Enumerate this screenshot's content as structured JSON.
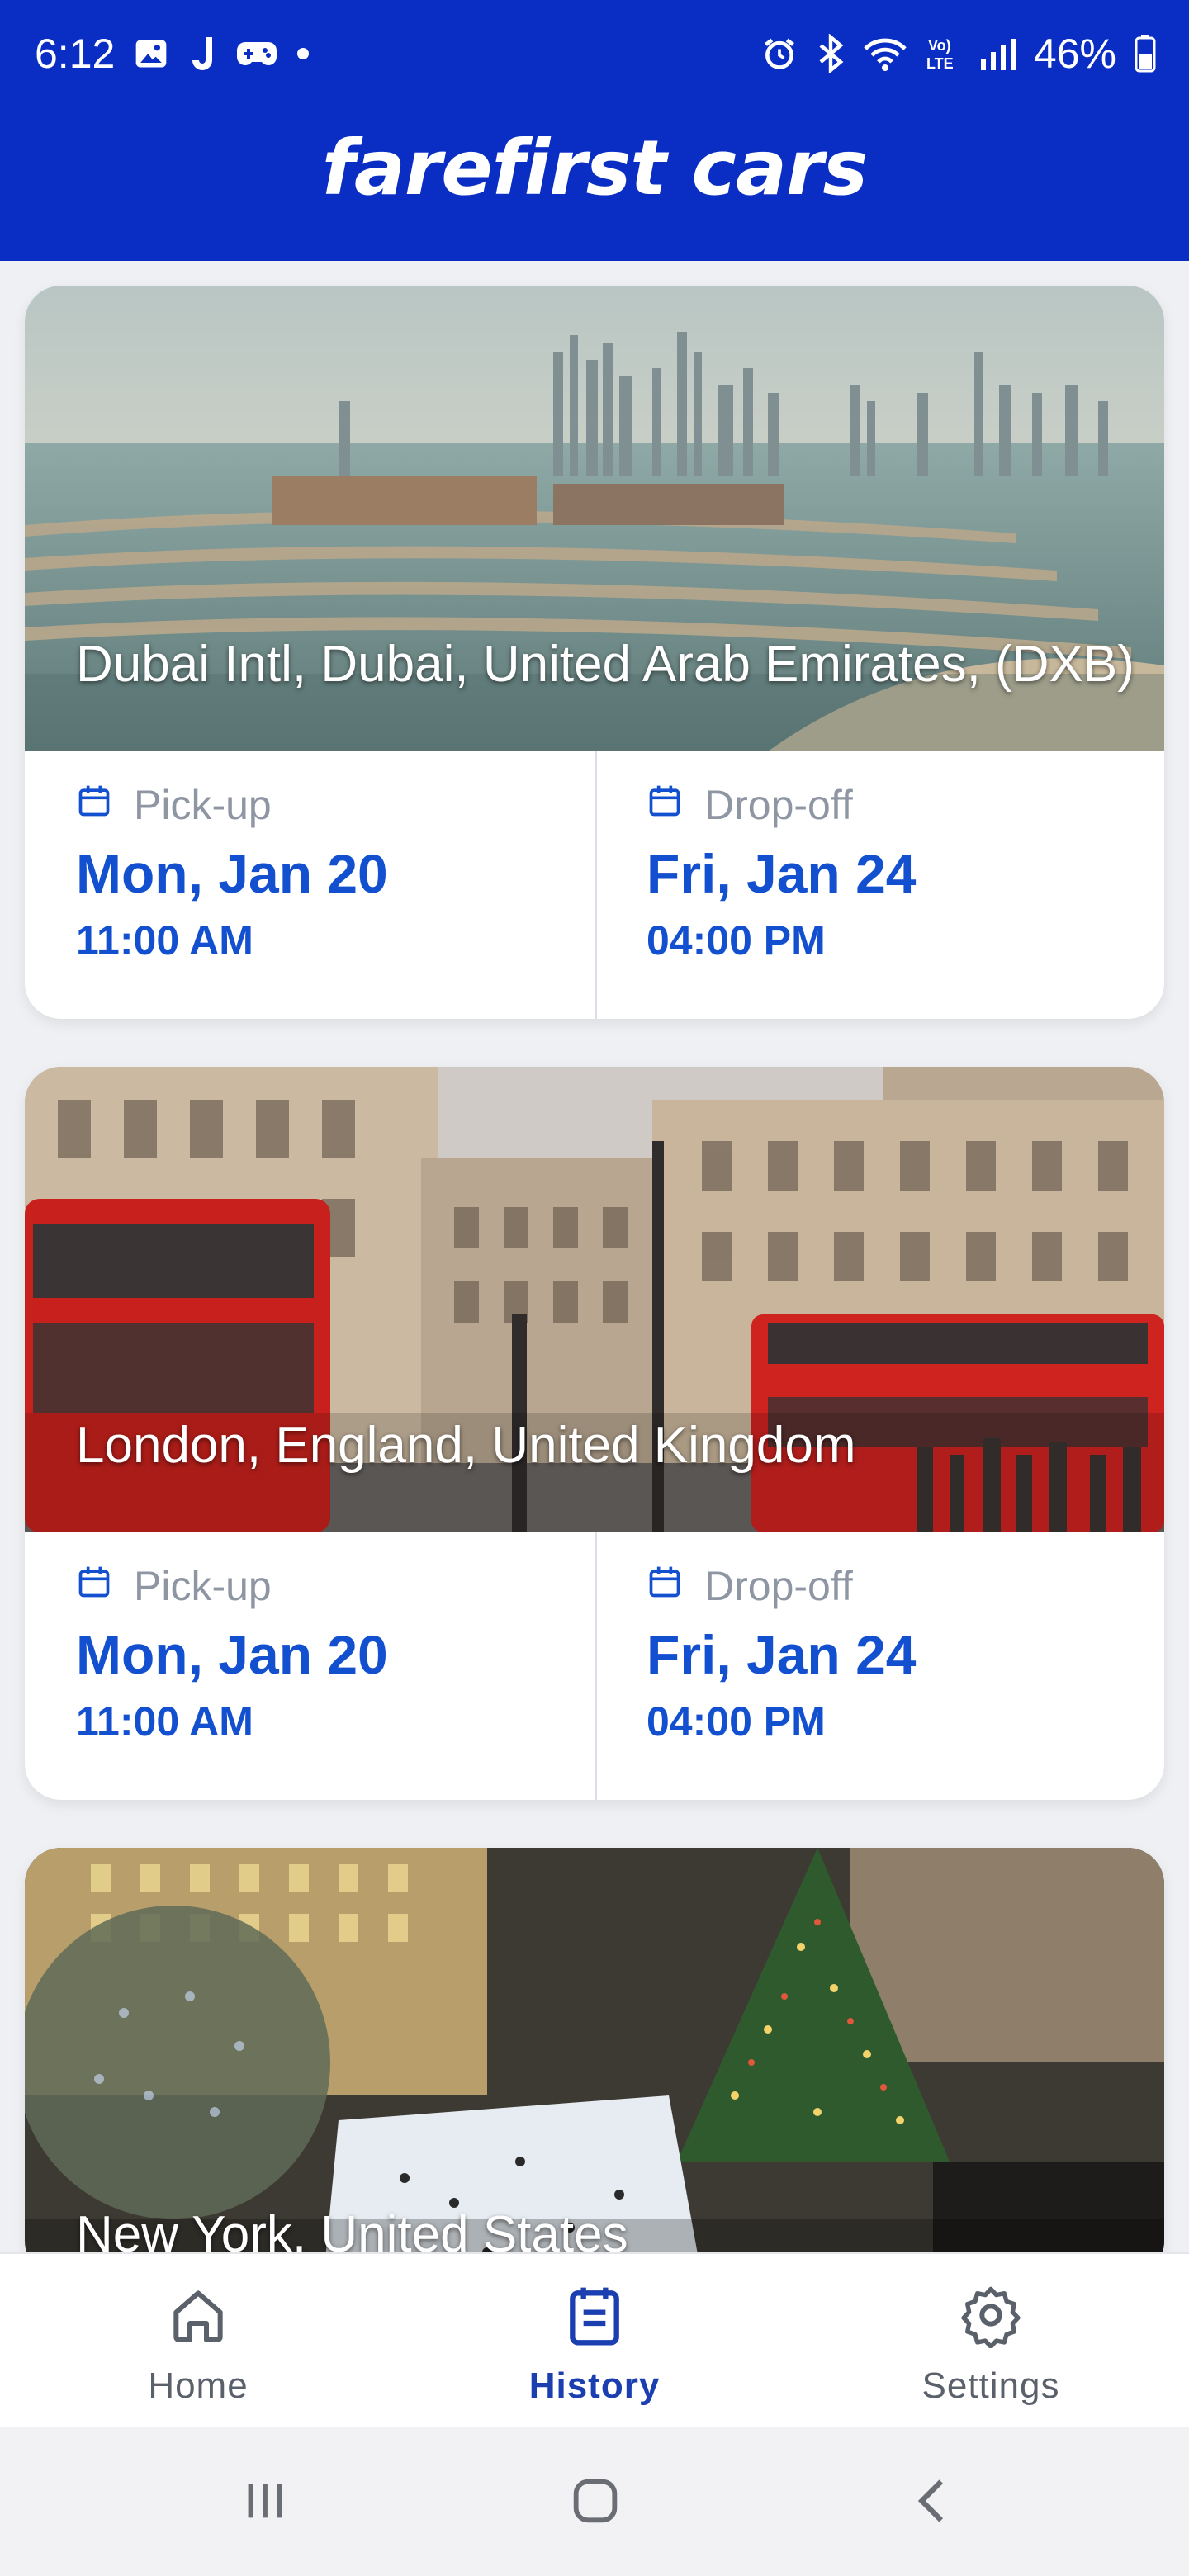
{
  "status_bar": {
    "time": "6:12",
    "battery": "46%",
    "left_icons": [
      "image-icon",
      "j-app-icon",
      "gamepad-icon",
      "dot-icon"
    ],
    "right_icons": [
      "alarm-icon",
      "bluetooth-icon",
      "wifi-icon",
      "volte-icon",
      "signal-icon",
      "battery-icon"
    ]
  },
  "header": {
    "logo_text": "farefirst cars"
  },
  "cards": [
    {
      "location": "Dubai Intl, Dubai, United Arab Emirates, (DXB)",
      "pickup": {
        "label": "Pick-up",
        "day": "Mon, Jan 20",
        "time": "11:00 AM"
      },
      "dropoff": {
        "label": "Drop-off",
        "day": "Fri, Jan 24",
        "time": "04:00 PM"
      }
    },
    {
      "location": "London, England, United Kingdom",
      "pickup": {
        "label": "Pick-up",
        "day": "Mon, Jan 20",
        "time": "11:00 AM"
      },
      "dropoff": {
        "label": "Drop-off",
        "day": "Fri, Jan 24",
        "time": "04:00 PM"
      }
    },
    {
      "location": "New York, United States"
    }
  ],
  "bottom_nav": {
    "items": [
      {
        "label": "Home",
        "icon": "home-icon"
      },
      {
        "label": "History",
        "icon": "history-icon",
        "active": true
      },
      {
        "label": "Settings",
        "icon": "settings-icon"
      }
    ]
  },
  "colors": {
    "brand": "#0a2ec4",
    "accent": "#1350d0",
    "muted": "#8f96a3"
  }
}
